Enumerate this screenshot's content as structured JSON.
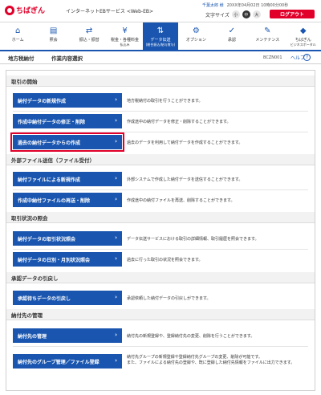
{
  "header": {
    "logo_text": "ちばぎん",
    "service_name": "インターネットEBサービス <Web-EB>",
    "user_name": "千葉太郎 様",
    "last_login": "20XX年04月02日 10時00分00秒",
    "font_size_label": "文字サイズ",
    "font_sizes": [
      "小",
      "中",
      "大"
    ],
    "logout_label": "ログアウト"
  },
  "nav": [
    {
      "label": "ホーム",
      "sub": "",
      "icon": "home-icon",
      "glyph": "⌂"
    },
    {
      "label": "照会",
      "sub": "",
      "icon": "inquiry-icon",
      "glyph": "▤"
    },
    {
      "label": "振込・振替",
      "sub": "",
      "icon": "transfer-icon",
      "glyph": "⇄"
    },
    {
      "label": "税金・各種料金",
      "sub": "払込み",
      "icon": "tax-payment-icon",
      "glyph": "¥"
    },
    {
      "label": "データ伝送",
      "sub": "(総合振込/給与賞与)",
      "icon": "data-transfer-icon",
      "glyph": "⇅"
    },
    {
      "label": "オプション",
      "sub": "",
      "icon": "option-icon",
      "glyph": "⚙"
    },
    {
      "label": "承認",
      "sub": "",
      "icon": "approval-icon",
      "glyph": "✓"
    },
    {
      "label": "メンテナンス",
      "sub": "",
      "icon": "maintenance-icon",
      "glyph": "✎"
    },
    {
      "label": "ちばぎん",
      "sub": "ビジネスポータル",
      "icon": "portal-icon",
      "glyph": "◆"
    }
  ],
  "title": {
    "category": "地方税納付",
    "page": "作業内容選択",
    "code": "BCZN001",
    "help_label": "ヘルプ"
  },
  "sections": [
    {
      "heading": "取引の開始",
      "rows": [
        {
          "button": "納付データの新規作成",
          "desc": "地方税納付の取引を行うことができます。"
        },
        {
          "button": "作成中納付データの修正・削除",
          "desc": "作成途中の納付データを修正・削除することができます。"
        },
        {
          "button": "過去の納付データからの作成",
          "desc": "過去のデータを利用して納付データを作成することができます。"
        }
      ]
    },
    {
      "heading": "外部ファイル送信（ファイル受付）",
      "rows": [
        {
          "button": "納付ファイルによる新規作成",
          "desc": "外部システムで作成した納付データを送信することができます。"
        },
        {
          "button": "作成中納付ファイルの再送・削除",
          "desc": "作成途中の納付ファイルを再送、削除することができます。"
        }
      ]
    },
    {
      "heading": "取引状況の照会",
      "rows": [
        {
          "button": "納付データの取引状況照会",
          "desc": "データ伝送サービスにおける取引の詳細情報、取引履歴を照会できます。"
        },
        {
          "button": "納付データの日別・月別状況照会",
          "desc": "過去に行った取引の状況を照会できます。"
        }
      ]
    },
    {
      "heading": "承認データの引戻し",
      "rows": [
        {
          "button": "承認待ちデータの引戻し",
          "desc": "承認依頼した納付データの引戻しができます。"
        }
      ]
    },
    {
      "heading": "納付先の管理",
      "rows": [
        {
          "button": "納付先の管理",
          "desc": "納付先の新規登録や、登録納付先の変更、削除を行うことができます。"
        },
        {
          "button": "納付先のグループ管理／ファイル登録",
          "desc": "納付先グループの新規登録や登録納付先グループの変更、削除が可能です。",
          "desc2": "また、ファイルによる納付先の登録や、既に登録した納付先情報をファイルに出力できます。"
        }
      ]
    }
  ]
}
